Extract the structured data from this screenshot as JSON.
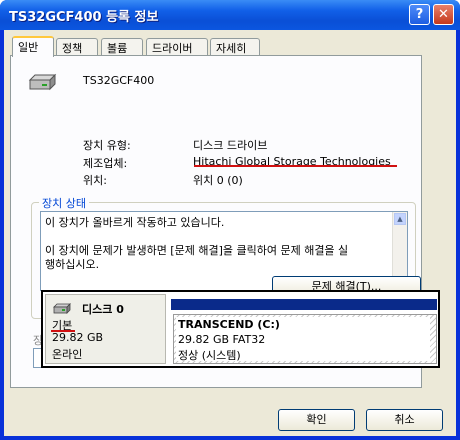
{
  "window": {
    "title": "TS32GCF400 등록 정보",
    "help": "?",
    "close": "✕"
  },
  "tabs": [
    {
      "label": "일반",
      "active": true
    },
    {
      "label": "정책"
    },
    {
      "label": "볼륨"
    },
    {
      "label": "드라이버"
    },
    {
      "label": "자세히"
    }
  ],
  "device": {
    "name": "TS32GCF400",
    "icon": "drive-icon",
    "properties": [
      {
        "label": "장치 유형:",
        "value": "디스크 드라이브"
      },
      {
        "label": "제조업체:",
        "value": "Hitachi Global Storage Technologies"
      },
      {
        "label": "위치:",
        "value": "위치 0 (0)"
      }
    ]
  },
  "status": {
    "group_title": "장치 상태",
    "lines": [
      "이 장치가 올바르게 작동하고 있습니다.",
      "",
      "이 장치에 문제가 발생하면 [문제 해결]을 클릭하여 문제 해결을 실",
      "행하십시오."
    ],
    "troubleshoot_button": "문제 해결(T)..."
  },
  "usage": {
    "label": "장"
  },
  "disk": {
    "title": "디스크 0",
    "type": "기본",
    "size": "29.82 GB",
    "state": "온라인",
    "partition": {
      "name": "TRANSCEND  (C:)",
      "size_fs": "29.82 GB FAT32",
      "status": "정상 (시스템)"
    }
  },
  "buttons": {
    "ok": "확인",
    "cancel": "취소"
  },
  "colors": {
    "title_bar": "#0a4fd6",
    "partition_header": "#0a2a8a",
    "annotation_underline": "#d01010",
    "tab_highlight": "#ffc83c"
  }
}
